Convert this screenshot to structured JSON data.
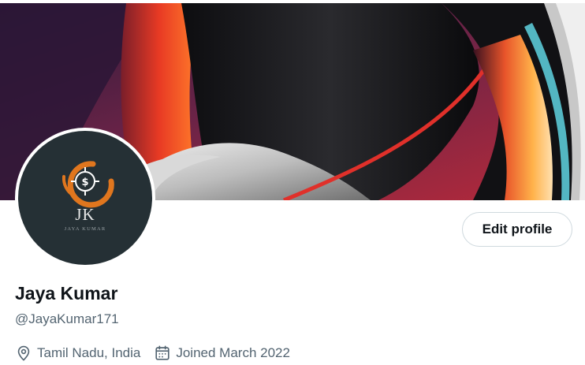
{
  "profile": {
    "avatar": {
      "initials": "JK",
      "name_caption": "JAYA KUMAR",
      "logo_symbol": "$"
    },
    "edit_button_label": "Edit profile",
    "display_name": "Jaya Kumar",
    "handle": "@JayaKumar171",
    "location": "Tamil Nadu, India",
    "joined": "Joined March 2022"
  },
  "icons": {
    "location": "location-pin-icon",
    "joined": "calendar-icon"
  },
  "colors": {
    "text_primary": "#0f1419",
    "text_secondary": "#536471",
    "button_border": "#cfd9de",
    "avatar_background": "#253035",
    "logo_accent": "#e0761e"
  }
}
